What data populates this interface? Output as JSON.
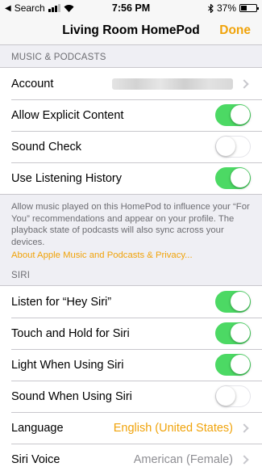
{
  "status_bar": {
    "carrier": "Search",
    "time": "7:56 PM",
    "battery": "37%",
    "battery_level": 0.37
  },
  "nav": {
    "title": "Living Room HomePod",
    "done_label": "Done"
  },
  "music": {
    "header": "MUSIC & PODCASTS",
    "account_label": "Account",
    "rows": [
      {
        "label": "Allow Explicit Content",
        "on": true
      },
      {
        "label": "Sound Check",
        "on": false
      },
      {
        "label": "Use Listening History",
        "on": true
      }
    ],
    "footer_text": "Allow music played on this HomePod to influence your “For You” recommendations and appear on your profile. The playback state of podcasts will also sync across your devices.",
    "footer_link": "About Apple Music and Podcasts & Privacy..."
  },
  "siri": {
    "header": "SIRI",
    "rows": [
      {
        "label": "Listen for “Hey Siri”",
        "on": true
      },
      {
        "label": "Touch and Hold for Siri",
        "on": true
      },
      {
        "label": "Light When Using Siri",
        "on": true
      },
      {
        "label": "Sound When Using Siri",
        "on": false
      }
    ],
    "language_label": "Language",
    "language_value": "English (United States)",
    "voice_label": "Siri Voice",
    "voice_value": "American (Female)"
  },
  "colors": {
    "accent": "#f0a30a",
    "toggle_on": "#4cd964"
  }
}
